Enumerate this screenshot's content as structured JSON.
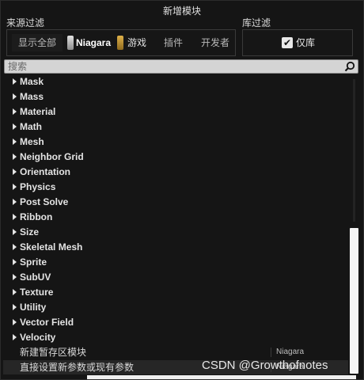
{
  "window": {
    "title": "新增模块"
  },
  "source_filter": {
    "label": "来源过滤",
    "options": [
      {
        "label": "显示全部",
        "selected": true
      },
      {
        "label": "Niagara",
        "swatch": "silver"
      },
      {
        "label": "游戏",
        "swatch": "gold"
      },
      {
        "label": "插件"
      },
      {
        "label": "开发者"
      }
    ]
  },
  "library_filter": {
    "label": "库过滤",
    "checkbox_label": "仅库",
    "checked": true
  },
  "search": {
    "placeholder": "搜索",
    "value": ""
  },
  "categories": [
    "Mask",
    "Mass",
    "Material",
    "Math",
    "Mesh",
    "Neighbor Grid",
    "Orientation",
    "Physics",
    "Post Solve",
    "Ribbon",
    "Size",
    "Skeletal Mesh",
    "Sprite",
    "SubUV",
    "Texture",
    "Utility",
    "Vector Field",
    "Velocity"
  ],
  "rows": [
    {
      "label": "新建暂存区模块",
      "source": "Niagara"
    },
    {
      "label": "直接设置新参数或现有参数",
      "source": "Niagara"
    }
  ],
  "watermark": "CSDN @Growthofnotes",
  "colors": {
    "background": "#151515",
    "text": "#e4e4e4",
    "search_bg": "#d4d4d4",
    "niagara": "#c0c0c0",
    "game": "#c99a38"
  }
}
